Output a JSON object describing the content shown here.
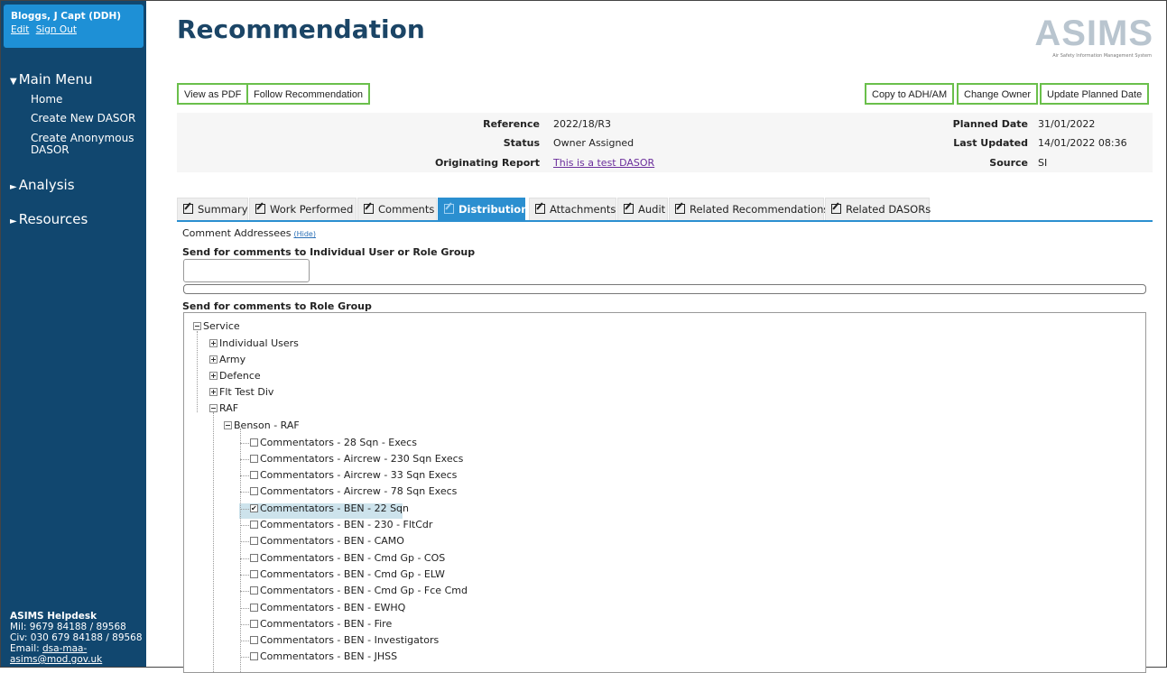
{
  "user": {
    "name": "Bloggs, J Capt (DDH)",
    "edit": "Edit",
    "signout": "Sign Out"
  },
  "menu": {
    "main": "Main Menu",
    "items": [
      "Home",
      "Create New DASOR",
      "Create Anonymous DASOR"
    ],
    "analysis": "Analysis",
    "resources": "Resources",
    "expanded_marker": "▼",
    "collapsed_marker": "►"
  },
  "helpdesk": {
    "title": "ASIMS Helpdesk",
    "mil": "Mil: 9679 84188 / 89568",
    "civ": "Civ: 030 679 84188 / 89568",
    "email_label": "Email: ",
    "email": "dsa-maa-asims@mod.gov.uk"
  },
  "page": {
    "title": "Recommendation"
  },
  "logo": {
    "text": "ASIMS",
    "subtitle": "Air Safety Information Management System"
  },
  "buttons": {
    "view_pdf": "View as PDF",
    "follow": "Follow Recommendation",
    "copy": "Copy to ADH/AM",
    "change_owner": "Change Owner",
    "update_date": "Update Planned Date"
  },
  "info": {
    "reference_label": "Reference",
    "reference": "2022/18/R3",
    "status_label": "Status",
    "status": "Owner Assigned",
    "orig_label": "Originating Report",
    "orig": "This is a test DASOR",
    "planned_label": "Planned Date",
    "planned": "31/01/2022",
    "updated_label": "Last Updated",
    "updated": "14/01/2022 08:36",
    "source_label": "Source",
    "source": "SI"
  },
  "tabs": [
    "Summary",
    "Work Performed",
    "Comments",
    "Distribution",
    "Attachments",
    "Audit",
    "Related Recommendations",
    "Related DASORs"
  ],
  "distribution": {
    "addressees": "Comment Addressees",
    "hide": "(Hide)",
    "individual_title": "Send for comments to Individual User or Role Group",
    "role_title": "Send for comments to Role Group"
  },
  "tree": {
    "service": "Service",
    "individual_users": "Individual Users",
    "army": "Army",
    "defence": "Defence",
    "flt_test": "Flt Test Div",
    "raf": "RAF",
    "benson": "Benson - RAF",
    "leaves": [
      "Commentators - 28 Sqn - Execs",
      "Commentators - Aircrew - 230 Sqn Execs",
      "Commentators - Aircrew - 33 Sqn Execs",
      "Commentators - Aircrew - 78 Sqn Execs",
      "Commentators - BEN - 22 Sqn",
      "Commentators - BEN - 230 - FltCdr",
      "Commentators - BEN - CAMO",
      "Commentators - BEN - Cmd Gp - COS",
      "Commentators - BEN - Cmd Gp - ELW",
      "Commentators - BEN - Cmd Gp - Fce Cmd",
      "Commentators - BEN - EWHQ",
      "Commentators - BEN - Fire",
      "Commentators - BEN - Investigators",
      "Commentators - BEN - JHSS"
    ]
  }
}
